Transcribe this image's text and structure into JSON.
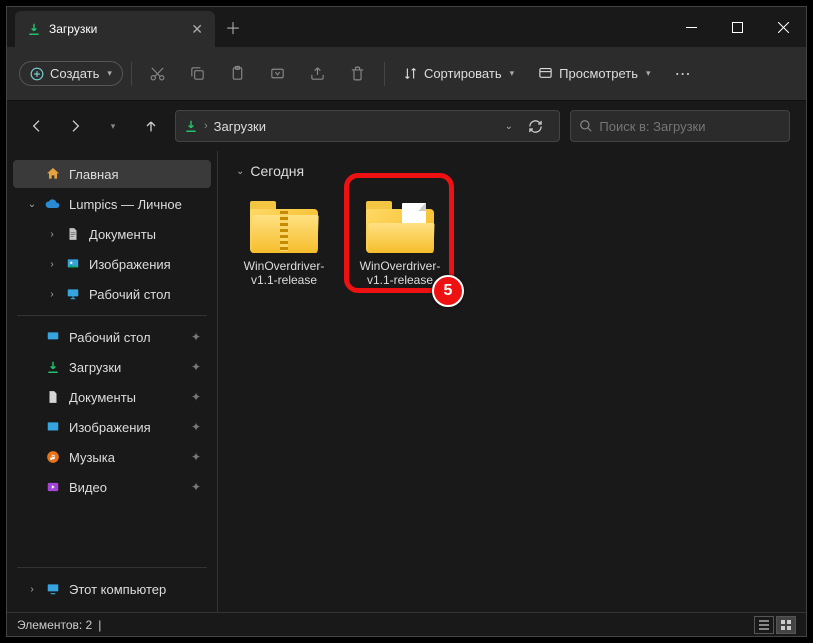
{
  "titlebar": {
    "tab_title": "Загрузки"
  },
  "toolbar": {
    "create": "Создать",
    "sort": "Сортировать",
    "view": "Просмотреть"
  },
  "nav": {
    "breadcrumb": "Загрузки",
    "search_placeholder": "Поиск в: Загрузки"
  },
  "sidebar": {
    "home": "Главная",
    "account": "Lumpics — Личное",
    "docs": "Документы",
    "images": "Изображения",
    "desktop": "Рабочий стол",
    "q_desktop": "Рабочий стол",
    "q_downloads": "Загрузки",
    "q_documents": "Документы",
    "q_images": "Изображения",
    "q_music": "Музыка",
    "q_video": "Видео",
    "this_pc": "Этот компьютер"
  },
  "content": {
    "group": "Сегодня",
    "items": [
      {
        "name": "WinOverdriver-v1.1-release",
        "type": "zip"
      },
      {
        "name": "WinOverdriver-v1.1-release",
        "type": "folder"
      }
    ],
    "callout": "5"
  },
  "status": {
    "count_label": "Элементов: 2"
  }
}
